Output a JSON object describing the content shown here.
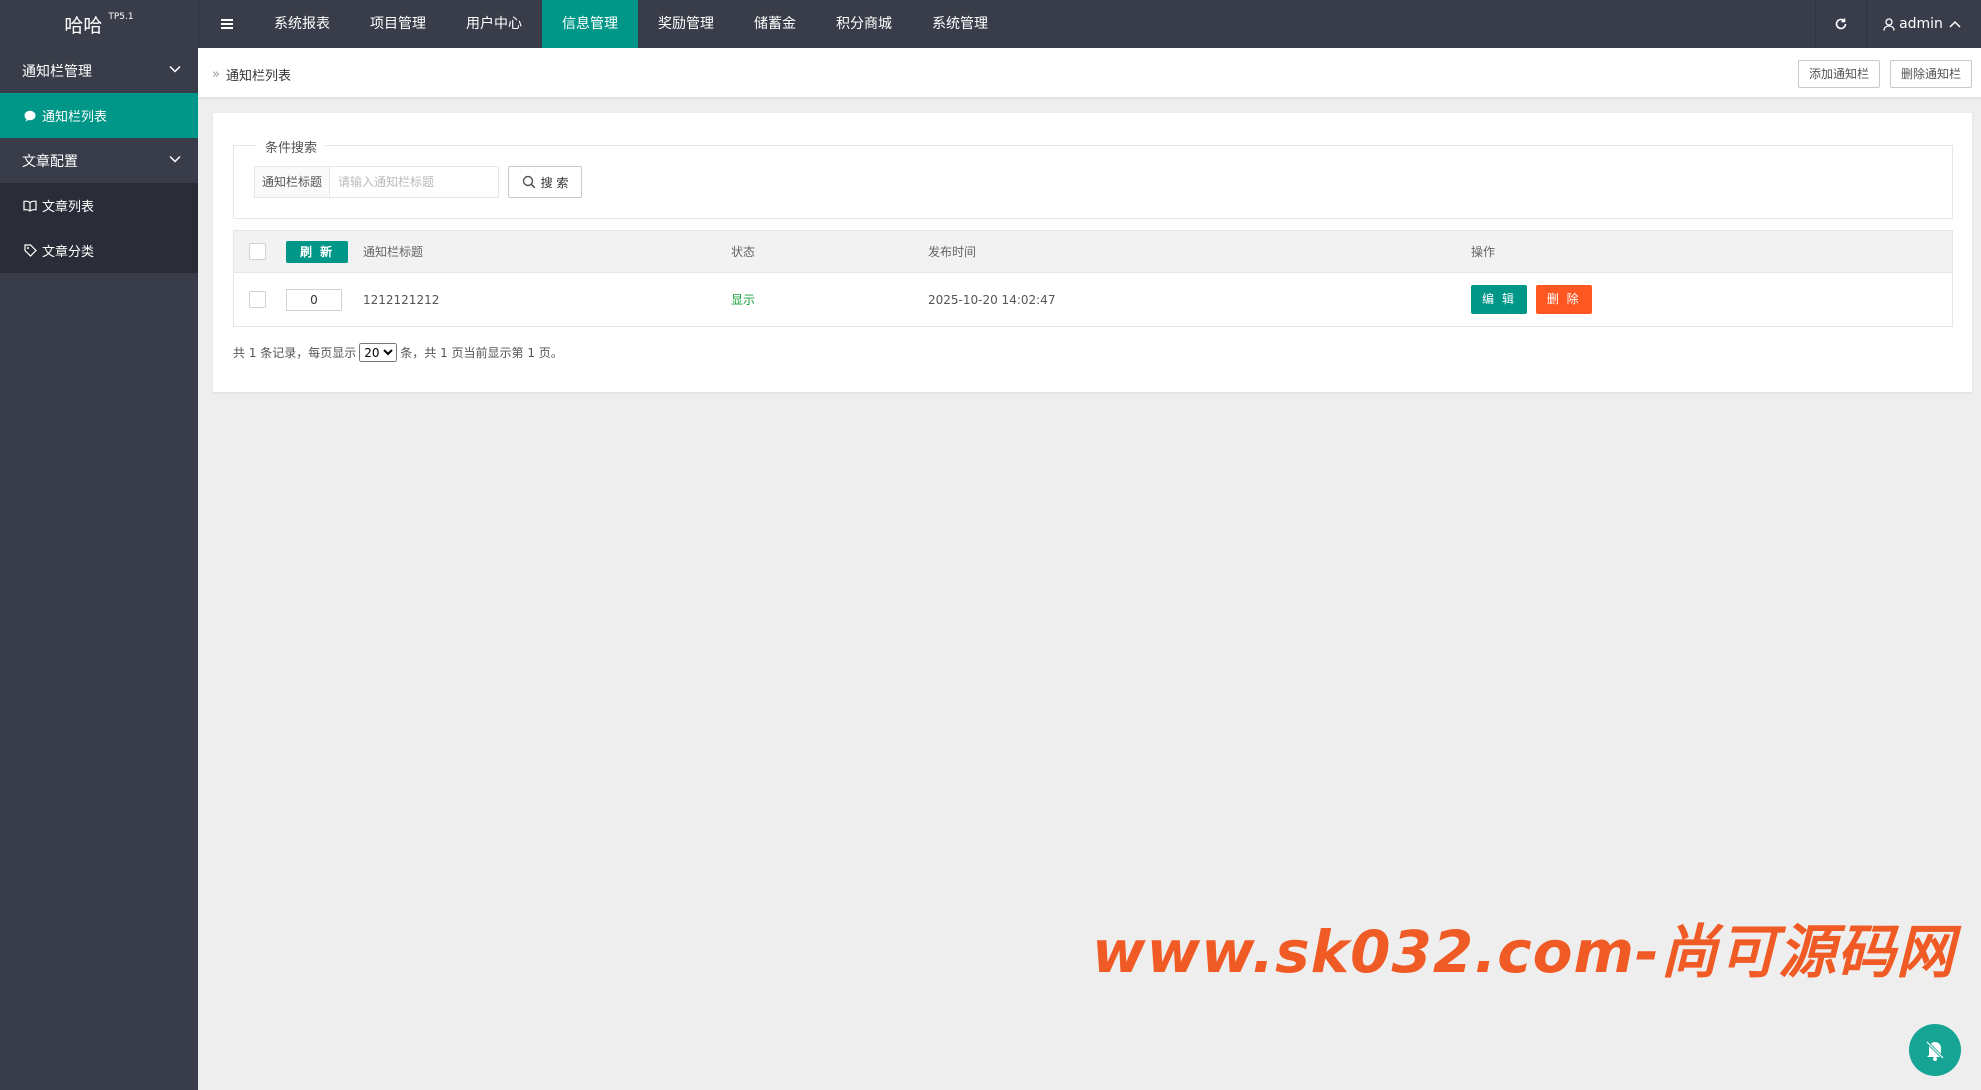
{
  "brand": {
    "name": "哈哈",
    "version": "TP5.1"
  },
  "topnav": {
    "items": [
      {
        "label": "系统报表",
        "active": false
      },
      {
        "label": "项目管理",
        "active": false
      },
      {
        "label": "用户中心",
        "active": false
      },
      {
        "label": "信息管理",
        "active": true
      },
      {
        "label": "奖励管理",
        "active": false
      },
      {
        "label": "储蓄金",
        "active": false
      },
      {
        "label": "积分商城",
        "active": false
      },
      {
        "label": "系统管理",
        "active": false
      }
    ],
    "user": "admin"
  },
  "sidebar": {
    "groups": [
      {
        "label": "通知栏管理",
        "items": [
          {
            "label": "通知栏列表",
            "icon": "chat-bubble-icon",
            "active": true
          }
        ]
      },
      {
        "label": "文章配置",
        "items": [
          {
            "label": "文章列表",
            "icon": "book-icon",
            "active": false
          },
          {
            "label": "文章分类",
            "icon": "tag-icon",
            "active": false
          }
        ]
      }
    ]
  },
  "breadcrumb": {
    "current": "通知栏列表"
  },
  "toolbar": {
    "add_label": "添加通知栏",
    "delete_label": "删除通知栏"
  },
  "search": {
    "legend": "条件搜索",
    "field_label": "通知栏标题",
    "placeholder": "请输入通知栏标题",
    "button_label": "搜 索"
  },
  "table": {
    "refresh_label": "刷 新",
    "headers": {
      "title": "通知栏标题",
      "status": "状态",
      "time": "发布时间",
      "action": "操作"
    },
    "rows": [
      {
        "sort": "0",
        "title": "1212121212",
        "status": "显示",
        "time": "2025-10-20 14:02:47",
        "edit": "编 辑",
        "delete": "删 除"
      }
    ]
  },
  "pager": {
    "prefix": "共 1 条记录，每页显示",
    "page_size": "20",
    "suffix": "条，共 1 页当前显示第 1 页。"
  },
  "watermark": "www.sk032.com-尚可源码网",
  "colors": {
    "accent": "#009688",
    "danger": "#ff5722",
    "topbar": "#393d49",
    "status_on": "#19a03d",
    "watermark": "#f05a24"
  }
}
